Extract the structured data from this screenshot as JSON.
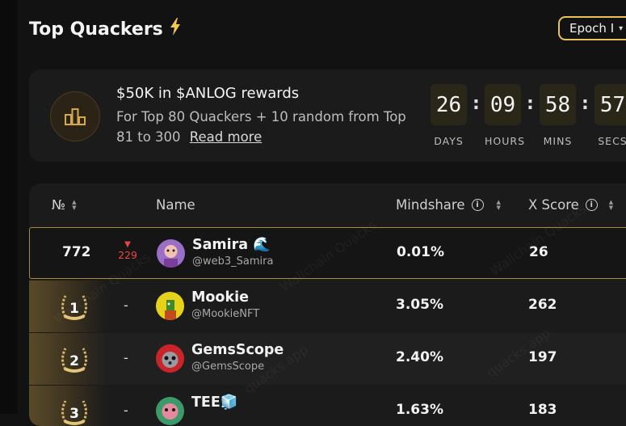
{
  "header": {
    "title": "Top Quackers",
    "title_icon": "lightning-bolt-icon",
    "epoch_label": "Epoch I"
  },
  "banner": {
    "title": "$50K in $ANLOG rewards",
    "description": "For Top 80 Quackers + 10 random from Top 81 to 300",
    "read_more": "Read more",
    "countdown": [
      {
        "value": "26",
        "label": "DAYS"
      },
      {
        "value": "09",
        "label": "HOURS"
      },
      {
        "value": "58",
        "label": "MINS"
      },
      {
        "value": "57",
        "label": "SECS"
      }
    ],
    "separator": ":"
  },
  "table": {
    "columns": {
      "rank": "№",
      "name": "Name",
      "mindshare": "Mindshare",
      "xscore": "X Score"
    },
    "self_row": {
      "rank": "772",
      "change": "229",
      "name": "Samira 🌊",
      "handle": "@web3_Samira",
      "mindshare": "0.01%",
      "xscore": "26"
    },
    "rows": [
      {
        "rank": "1",
        "change": "-",
        "name": "Mookie",
        "handle": "@MookieNFT",
        "mindshare": "3.05%",
        "xscore": "262"
      },
      {
        "rank": "2",
        "change": "-",
        "name": "GemsScope",
        "handle": "@GemsScope",
        "mindshare": "2.40%",
        "xscore": "197"
      },
      {
        "rank": "3",
        "change": "-",
        "name": "TEE🧊",
        "handle": "",
        "mindshare": "1.63%",
        "xscore": "183"
      }
    ]
  },
  "watermarks": [
    "Wallchain Quacks",
    "quacks.app"
  ],
  "colors": {
    "accent": "#e9c25a",
    "negative": "#e44444",
    "background": "#121212",
    "panel": "#1b1b1b"
  }
}
